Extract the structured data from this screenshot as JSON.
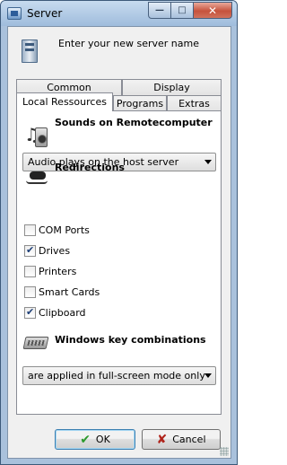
{
  "window": {
    "title": "Server",
    "minimize_glyph": "—",
    "maximize_glyph": "□",
    "close_glyph": "✕"
  },
  "header": {
    "text": "Enter your new server name",
    "icon": "server-icon"
  },
  "tabs": {
    "row1": [
      {
        "label": "Common"
      },
      {
        "label": "Display"
      }
    ],
    "row2": [
      {
        "label": "Local Ressources",
        "active": true
      },
      {
        "label": "Programs"
      },
      {
        "label": "Extras"
      }
    ]
  },
  "sounds": {
    "title": "Sounds on Remotecomputer",
    "icon": "speaker-icon",
    "selected": "Audio plays on the host server"
  },
  "redirections": {
    "title": "Redirections",
    "icon": "plug-icon",
    "items": [
      {
        "label": "COM Ports",
        "checked": false
      },
      {
        "label": "Drives",
        "checked": true
      },
      {
        "label": "Printers",
        "checked": false
      },
      {
        "label": "Smart Cards",
        "checked": false
      },
      {
        "label": "Clipboard",
        "checked": true
      }
    ]
  },
  "windows_keys": {
    "title": "Windows key combinations",
    "icon": "keyboard-icon",
    "selected": "are applied in full-screen mode only"
  },
  "buttons": {
    "ok": "OK",
    "cancel": "Cancel"
  },
  "colors": {
    "ok_icon": "#2c9a2c",
    "cancel_icon": "#b0241c",
    "frame": "#a9c1dc"
  }
}
